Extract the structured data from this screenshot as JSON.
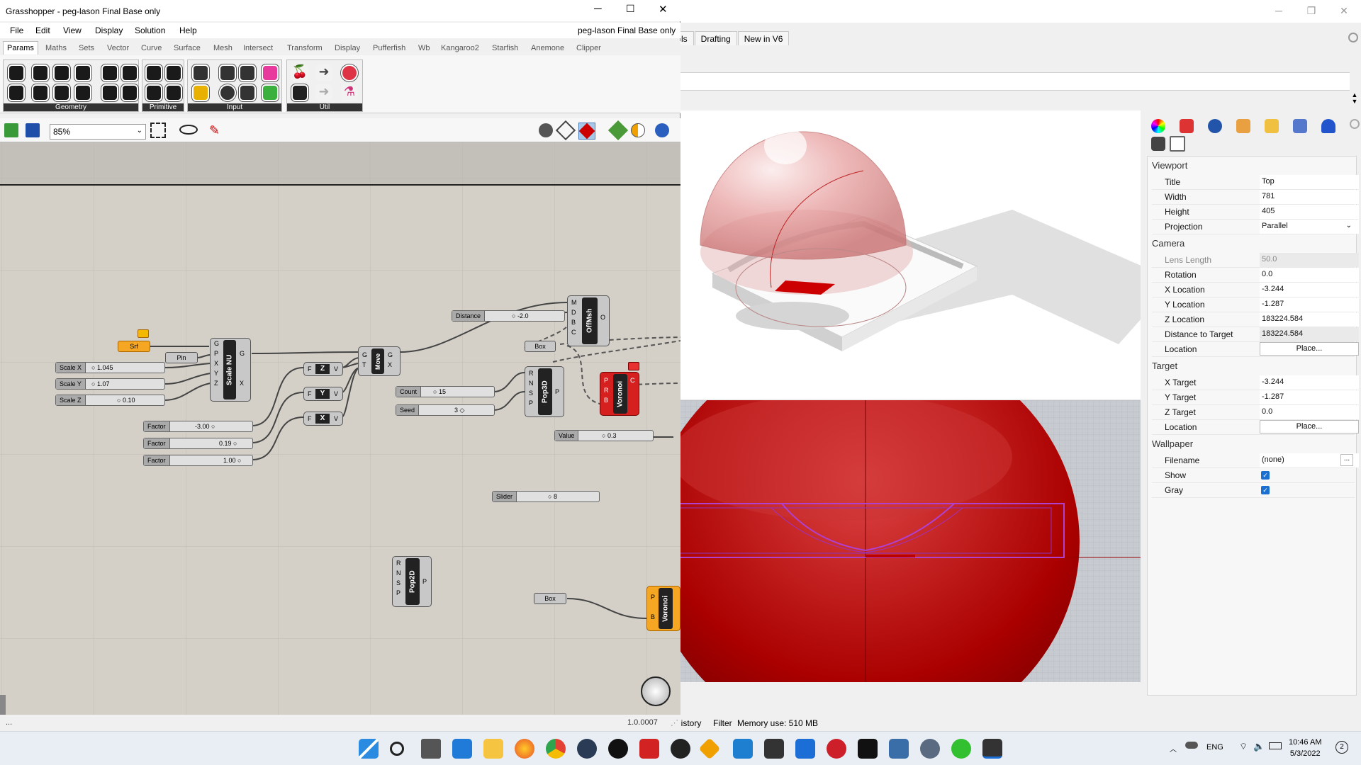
{
  "grasshopper": {
    "title": "Grasshopper - peg-lason Final Base only",
    "doc_name": "peg-lason Final Base only",
    "menu": [
      "File",
      "Edit",
      "View",
      "Display",
      "Solution",
      "Help"
    ],
    "tabs": [
      "Params",
      "Maths",
      "Sets",
      "Vector",
      "Curve",
      "Surface",
      "Mesh",
      "Intersect",
      "Transform",
      "Display",
      "Pufferfish",
      "Wb",
      "Kangaroo2",
      "Starfish",
      "Anemone",
      "Clipper"
    ],
    "ribbon_groups": [
      "Geometry",
      "Primitive",
      "Input",
      "Util"
    ],
    "zoom": "85%",
    "status_left": "...",
    "version": "1.0.0007",
    "components": {
      "srf": "Srf",
      "pin": "Pin",
      "scale_nu": "Scale NU",
      "move": "Move",
      "offmsh": "OffMsh",
      "pop3d": "Pop3D",
      "voronoi": "Voronoi",
      "pop2d": "Pop2D",
      "voronoi2": "Voronoi",
      "box1": "Box",
      "box2": "Box",
      "z": "Z",
      "y": "Y",
      "x": "X"
    },
    "sliders": {
      "scale_x": {
        "label": "Scale X",
        "value": "1.045"
      },
      "scale_y": {
        "label": "Scale Y",
        "value": "1.07"
      },
      "scale_z": {
        "label": "Scale Z",
        "value": "0.10"
      },
      "factor1": {
        "label": "Factor",
        "value": "-3.00"
      },
      "factor2": {
        "label": "Factor",
        "value": "0.19"
      },
      "factor3": {
        "label": "Factor",
        "value": "1.00"
      },
      "distance": {
        "label": "Distance",
        "value": "-2.0"
      },
      "count": {
        "label": "Count",
        "value": "15"
      },
      "seed": {
        "label": "Seed",
        "value": "3"
      },
      "value": {
        "label": "Value",
        "value": "0.3"
      },
      "slider": {
        "label": "Slider",
        "value": "8"
      }
    }
  },
  "rhino": {
    "tabs": [
      "ls",
      "Drafting",
      "New in V6"
    ],
    "status": {
      "history": "listory",
      "filter": "Filter",
      "memory": "Memory use: 510 MB"
    }
  },
  "properties": {
    "viewport_header": "Viewport",
    "viewport": [
      {
        "key": "Title",
        "value": "Top"
      },
      {
        "key": "Width",
        "value": "781"
      },
      {
        "key": "Height",
        "value": "405"
      },
      {
        "key": "Projection",
        "value": "Parallel"
      }
    ],
    "camera_header": "Camera",
    "camera": [
      {
        "key": "Lens Length",
        "value": "50.0"
      },
      {
        "key": "Rotation",
        "value": "0.0"
      },
      {
        "key": "X Location",
        "value": "-3.244"
      },
      {
        "key": "Y Location",
        "value": "-1.287"
      },
      {
        "key": "Z Location",
        "value": "183224.584"
      },
      {
        "key": "Distance to Target",
        "value": "183224.584"
      },
      {
        "key": "Location",
        "value": "Place..."
      }
    ],
    "target_header": "Target",
    "target": [
      {
        "key": "X Target",
        "value": "-3.244"
      },
      {
        "key": "Y Target",
        "value": "-1.287"
      },
      {
        "key": "Z Target",
        "value": "0.0"
      },
      {
        "key": "Location",
        "value": "Place..."
      }
    ],
    "wallpaper_header": "Wallpaper",
    "wallpaper": [
      {
        "key": "Filename",
        "value": "(none)"
      },
      {
        "key": "Show",
        "value": "checked"
      },
      {
        "key": "Gray",
        "value": "checked"
      }
    ]
  },
  "taskbar": {
    "lang": "ENG",
    "time": "10:46 AM",
    "date": "5/3/2022",
    "badge": "2"
  }
}
